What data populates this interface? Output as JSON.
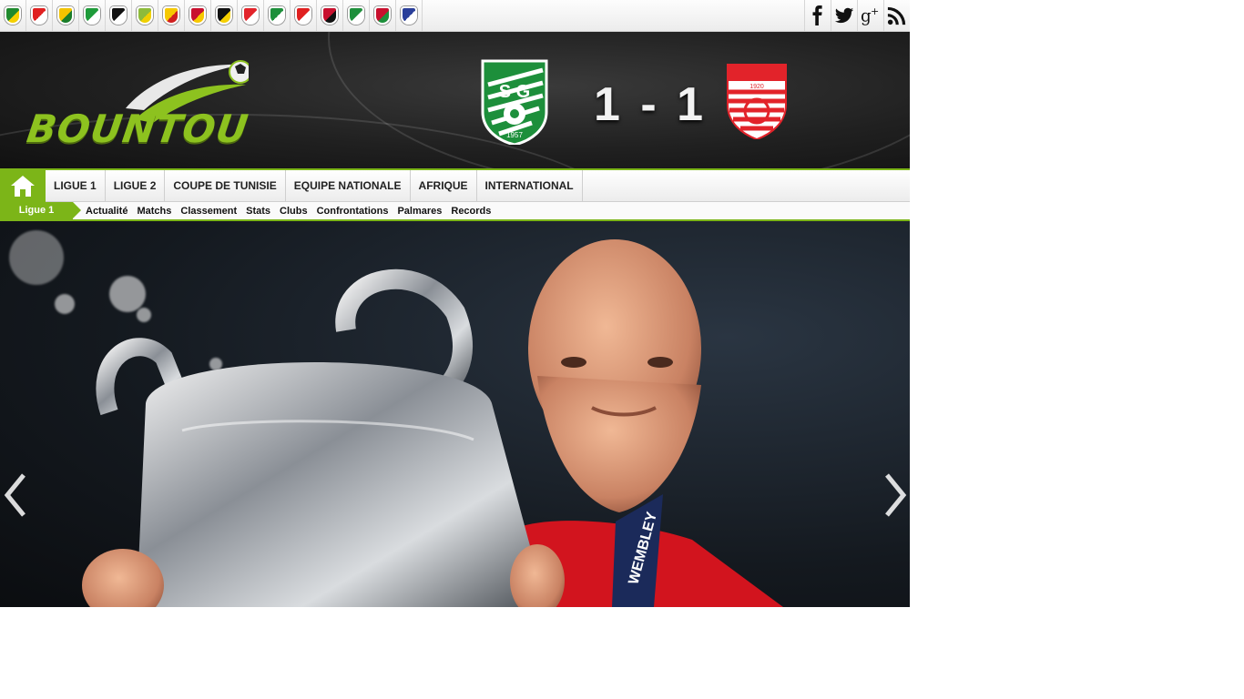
{
  "clubs": [
    {
      "name": "club-1-badge",
      "color": "#1f8a2e",
      "accent": "#f5d000"
    },
    {
      "name": "club-2-badge",
      "color": "#e02020",
      "accent": "#ffffff"
    },
    {
      "name": "club-3-badge",
      "color": "#f2c300",
      "accent": "#1a7d2a"
    },
    {
      "name": "club-4-badge",
      "color": "#1e9b3a",
      "accent": "#ffffff"
    },
    {
      "name": "club-5-badge",
      "color": "#111111",
      "accent": "#ffffff"
    },
    {
      "name": "club-6-badge",
      "color": "#8dbb3a",
      "accent": "#f0d000"
    },
    {
      "name": "club-7-badge",
      "color": "#f6c800",
      "accent": "#d02020"
    },
    {
      "name": "club-8-badge",
      "color": "#c8102e",
      "accent": "#f6c800"
    },
    {
      "name": "club-9-badge",
      "color": "#111111",
      "accent": "#f6d000"
    },
    {
      "name": "club-10-badge",
      "color": "#e2232a",
      "accent": "#ffffff"
    },
    {
      "name": "club-11-badge",
      "color": "#1d8f3b",
      "accent": "#ffffff"
    },
    {
      "name": "club-12-badge",
      "color": "#e02020",
      "accent": "#ffffff"
    },
    {
      "name": "club-13-badge",
      "color": "#c8102e",
      "accent": "#111111"
    },
    {
      "name": "club-14-badge",
      "color": "#1d8f3b",
      "accent": "#ffffff"
    },
    {
      "name": "club-15-badge",
      "color": "#c8102e",
      "accent": "#1d8f3b"
    },
    {
      "name": "club-16-badge",
      "color": "#2a3f9a",
      "accent": "#ffffff"
    }
  ],
  "social": [
    {
      "name": "facebook-icon"
    },
    {
      "name": "twitter-icon"
    },
    {
      "name": "google-plus-icon"
    },
    {
      "name": "rss-icon"
    }
  ],
  "header": {
    "logo_text": "BOUNTOU",
    "score": "1 - 1",
    "home_team_badge": "stade-gabesien-badge",
    "away_team_badge": "club-africain-badge",
    "home_badge_text": "S G",
    "home_badge_year": "1957",
    "away_badge_year": "1920"
  },
  "nav": {
    "home_icon": "home-icon",
    "items": [
      "LIGUE 1",
      "LIGUE 2",
      "COUPE DE TUNISIE",
      "EQUIPE NATIONALE",
      "AFRIQUE",
      "INTERNATIONAL"
    ]
  },
  "subnav": {
    "section": "Ligue 1",
    "links": [
      "Actualité",
      "Matchs",
      "Classement",
      "Stats",
      "Clubs",
      "Confrontations",
      "Palmares",
      "Records"
    ]
  },
  "hero": {
    "medal_ribbon_text": "WEMBLEY",
    "colors": {
      "accent": "#7cb518",
      "jersey": "#d2141e"
    }
  }
}
